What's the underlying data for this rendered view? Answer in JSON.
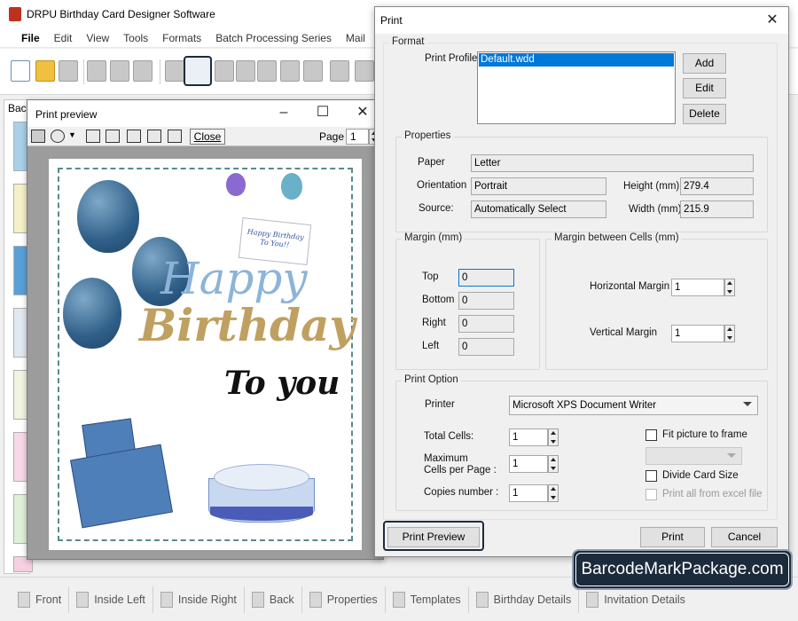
{
  "app": {
    "title": "DRPU Birthday Card Designer Software"
  },
  "menu": [
    "File",
    "Edit",
    "View",
    "Tools",
    "Formats",
    "Batch Processing Series",
    "Mail"
  ],
  "left_panel": {
    "label": "Bac"
  },
  "bottom_tabs": [
    "Front",
    "Inside Left",
    "Inside Right",
    "Back",
    "Properties",
    "Templates",
    "Birthday Details",
    "Invitation Details"
  ],
  "preview": {
    "title": "Print preview",
    "close_label": "Close",
    "page_label": "Page",
    "page_value": "1",
    "card": {
      "happy": "Happy",
      "birthday": "Birthday",
      "to_you": "To you",
      "note": "Happy Birthday To You!!"
    }
  },
  "dialog": {
    "title": "Print",
    "format": {
      "label": "Format",
      "profile_label": "Print Profile",
      "profiles": [
        "Default.wdd"
      ],
      "add": "Add",
      "edit": "Edit",
      "delete": "Delete"
    },
    "properties": {
      "label": "Properties",
      "paper_label": "Paper",
      "paper": "Letter",
      "orientation_label": "Orientation",
      "orientation": "Portrait",
      "source_label": "Source:",
      "source": "Automatically Select",
      "height_label": "Height (mm)",
      "height": "279.4",
      "width_label": "Width (mm)",
      "width": "215.9"
    },
    "margin": {
      "label": "Margin (mm)",
      "top_label": "Top",
      "top": "0",
      "bottom_label": "Bottom",
      "bottom": "0",
      "right_label": "Right",
      "right": "0",
      "left_label": "Left",
      "left": "0"
    },
    "cell_margin": {
      "label": "Margin between Cells (mm)",
      "horizontal_label": "Horizontal Margin",
      "horizontal": "1",
      "vertical_label": "Vertical Margin",
      "vertical": "1"
    },
    "print_option": {
      "label": "Print Option",
      "printer_label": "Printer",
      "printer": "Microsoft XPS Document Writer",
      "total_cells_label": "Total Cells:",
      "total_cells": "1",
      "max_cells_label_1": "Maximum",
      "max_cells_label_2": "Cells per Page :",
      "max_cells": "1",
      "copies_label": "Copies number :",
      "copies": "1",
      "fit_label": "Fit picture to frame",
      "divide_label": "Divide Card Size",
      "excel_label": "Print all from excel file"
    },
    "print_preview": "Print Preview",
    "print": "Print",
    "cancel": "Cancel"
  },
  "watermark": "BarcodeMarkPackage.com"
}
